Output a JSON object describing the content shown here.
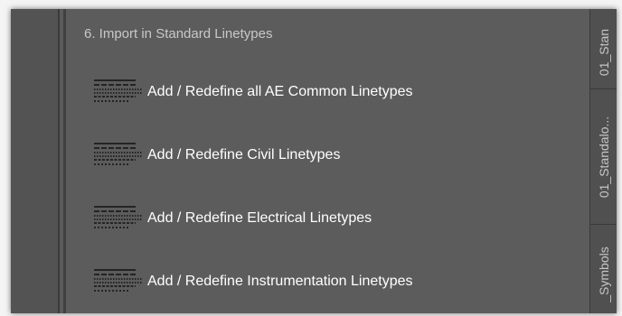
{
  "section": {
    "title": "6. Import in Standard Linetypes"
  },
  "items": [
    {
      "label": "Add / Redefine all AE Common Linetypes",
      "icon": "linetype-icon"
    },
    {
      "label": "Add / Redefine Civil Linetypes",
      "icon": "linetype-icon"
    },
    {
      "label": "Add / Redefine Electrical Linetypes",
      "icon": "linetype-icon"
    },
    {
      "label": "Add / Redefine Instrumentation Linetypes",
      "icon": "linetype-icon"
    }
  ],
  "tabs": [
    {
      "label": "01_Stan"
    },
    {
      "label": "01_Standalo..."
    },
    {
      "label": "_Symbols"
    }
  ],
  "colors": {
    "panel_bg": "#5c5c5c",
    "label_text": "#ffffff",
    "title_text": "#c8c8c8",
    "tab_bg": "#505050"
  }
}
